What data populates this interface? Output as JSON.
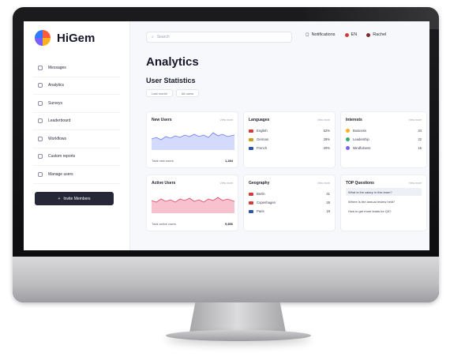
{
  "app": {
    "name": "HiGem"
  },
  "sidebar": {
    "items": [
      {
        "label": "Messages",
        "icon": "message-icon"
      },
      {
        "label": "Analytics",
        "icon": "analytics-icon"
      },
      {
        "label": "Surveys",
        "icon": "survey-icon"
      },
      {
        "label": "Leaderboard",
        "icon": "trophy-icon"
      },
      {
        "label": "Workflows",
        "icon": "workflow-icon"
      },
      {
        "label": "Custom reports",
        "icon": "report-icon"
      },
      {
        "label": "Manage users",
        "icon": "users-icon"
      }
    ],
    "cta_label": "Invite Members"
  },
  "topbar": {
    "search_placeholder": "Search",
    "notifications_label": "Notifications",
    "language_label": "EN",
    "user_name": "Rachel"
  },
  "main": {
    "title": "Analytics",
    "section_title": "User Statistics",
    "filters": [
      "Last month",
      "All users"
    ]
  },
  "cards": {
    "new_users": {
      "title": "New Users",
      "link": "View more",
      "foot_label": "Total new users",
      "foot_value": "1,284"
    },
    "active_users": {
      "title": "Active Users",
      "link": "View more",
      "foot_label": "Total active users",
      "foot_value": "9,856"
    },
    "languages": {
      "title": "Languages",
      "link": "View more",
      "rows": [
        {
          "name": "English",
          "value": "52%",
          "color": "#d23b3b"
        },
        {
          "name": "German",
          "value": "28%",
          "color": "#c8a31a"
        },
        {
          "name": "French",
          "value": "20%",
          "color": "#2c54a8"
        }
      ]
    },
    "interests": {
      "title": "Interests",
      "link": "View more",
      "rows": [
        {
          "name": "Business",
          "value": "34",
          "color": "#ffb020"
        },
        {
          "name": "Leadership",
          "value": "22",
          "color": "#3ba86b"
        },
        {
          "name": "Mindfulness",
          "value": "15",
          "color": "#7b5cff"
        }
      ]
    },
    "geography": {
      "title": "Geography",
      "link": "View more",
      "rows": [
        {
          "name": "Berlin",
          "value": "41",
          "color": "#d23b3b"
        },
        {
          "name": "Copenhagen",
          "value": "28",
          "color": "#d23b3b"
        },
        {
          "name": "Paris",
          "value": "19",
          "color": "#2c54a8"
        }
      ]
    },
    "top_questions": {
      "title": "TOP Questions",
      "link": "View more",
      "items": [
        "What is the salary in this team?",
        "Where is the annual review held?",
        "How to get more leads for Q3?"
      ]
    }
  },
  "colors": {
    "new_users_line": "#6a7cf0",
    "active_users_line": "#e2476a",
    "cta_bg": "#262838"
  }
}
